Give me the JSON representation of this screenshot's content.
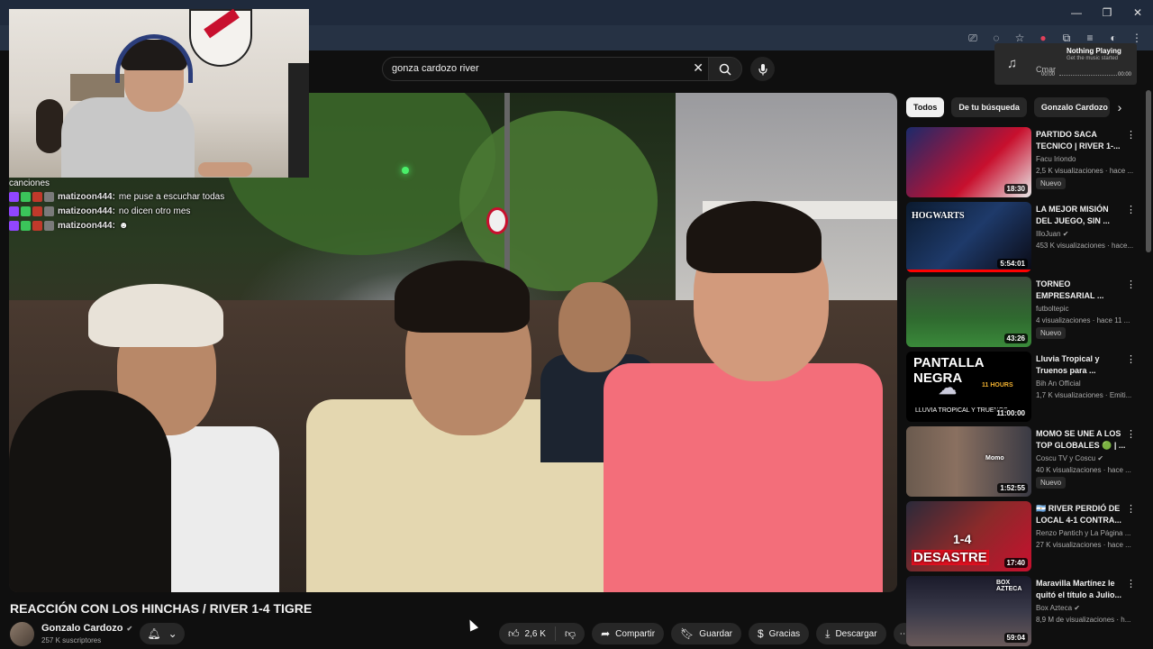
{
  "now_playing": {
    "title": "Nothing Playing",
    "subtitle": "Get the music started",
    "time_start": "00:00",
    "time_end": "00:00",
    "cover_label": "Cmar"
  },
  "search": {
    "query": "gonza cardozo river"
  },
  "chat": {
    "header": "canciones",
    "messages": [
      {
        "user": "matizoon444:",
        "text": "me puse a escuchar todas"
      },
      {
        "user": "matizoon444:",
        "text": "no dicen otro mes"
      },
      {
        "user": "matizoon444:",
        "text": ""
      }
    ]
  },
  "video": {
    "title": "REACCIÓN CON LOS HINCHAS / RIVER 1-4 TIGRE",
    "channel": "Gonzalo Cardozo",
    "subscribers": "257 K suscriptores"
  },
  "actions": {
    "likes": "2,6 K",
    "share": "Compartir",
    "save": "Guardar",
    "thanks": "Gracias",
    "download": "Descargar"
  },
  "chips": [
    "Todos",
    "De tu búsqueda",
    "Gonzalo Cardozo"
  ],
  "recommendations": [
    {
      "title": "PARTIDO SACA TECNICO | RIVER 1-...",
      "channel": "Facu Iriondo",
      "meta": "2,5 K visualizaciones · hace ...",
      "badge": "Nuevo",
      "duration": "18:30",
      "thumb_text": ""
    },
    {
      "title": "LA MEJOR MISIÓN DEL JUEGO, SIN ...",
      "channel": "IlloJuan ✔",
      "meta": "453 K visualizaciones · hace...",
      "badge": "",
      "duration": "5:54:01",
      "thumb_text": "HOGWARTS"
    },
    {
      "title": "TORNEO EMPRESARIAL ...",
      "channel": "futboltepic",
      "meta": "4 visualizaciones · hace 11 ...",
      "badge": "Nuevo",
      "duration": "43:26",
      "thumb_text": ""
    },
    {
      "title": "Lluvia Tropical y Truenos para ...",
      "channel": "Bih An Official",
      "meta": "1,7 K visualizaciones · Emiti...",
      "badge": "",
      "duration": "11:00:00",
      "thumb_text": "PANTALLA NEGRA",
      "thumb_sub": "LLUVIA TROPICAL Y TRUENOS",
      "thumb_hours": "11 HOURS"
    },
    {
      "title": "MOMO SE UNE A LOS TOP GLOBALES 🟢 | ...",
      "channel": "Coscu TV y Coscu ✔",
      "meta": "40 K visualizaciones · hace ...",
      "badge": "Nuevo",
      "duration": "1:52:55",
      "thumb_text": "Momo"
    },
    {
      "title": "🇦🇷 RIVER PERDIÓ DE LOCAL 4-1 CONTRA...",
      "channel": "Renzo Pantich y La Página ...",
      "meta": "27 K visualizaciones · hace ...",
      "badge": "",
      "duration": "17:40",
      "thumb_text": "DESASTRE",
      "thumb_score": "1-4"
    },
    {
      "title": "Maravilla Martínez le quitó el título a Julio...",
      "channel": "Box Azteca ✔",
      "meta": "8,9 M de visualizaciones · h...",
      "badge": "",
      "duration": "59:04",
      "thumb_text": "BOX AZTECA"
    }
  ],
  "colors": {
    "accent_red": "#ff0000",
    "background": "#0f0f0f",
    "browser_chrome": "#1f2a3c"
  }
}
